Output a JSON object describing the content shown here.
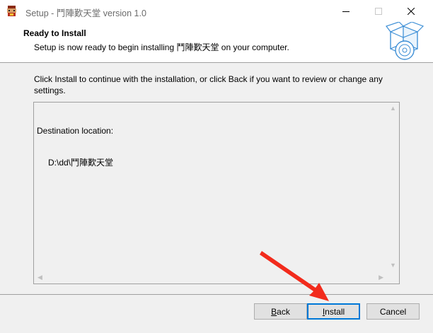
{
  "window": {
    "title": "Setup - 鬥陣歎天堂 version 1.0",
    "icons": {
      "app": "setup-app-icon",
      "minimize": "minimize-icon",
      "maximize": "maximize-icon",
      "close": "close-icon"
    }
  },
  "header": {
    "title": "Ready to Install",
    "subtitle": "Setup is now ready to begin installing 鬥陣歎天堂 on your computer.",
    "image": "install-box-cd-icon"
  },
  "body": {
    "instruction": "Click Install to continue with the installation, or click Back if you want to review or change any settings.",
    "memo": {
      "label": "Destination location:",
      "value": "D:\\dd\\鬥陣歎天堂"
    }
  },
  "buttons": {
    "back_prefix": "",
    "back_accel": "B",
    "back_rest": "ack",
    "install_prefix": "",
    "install_accel": "I",
    "install_rest": "nstall",
    "cancel": "Cancel"
  },
  "annotation": {
    "arrow_color": "#f22b1c"
  },
  "colors": {
    "focus_border": "#0078d7",
    "button_bg": "#e1e1e1",
    "dialog_bg": "#f0f0f0"
  }
}
